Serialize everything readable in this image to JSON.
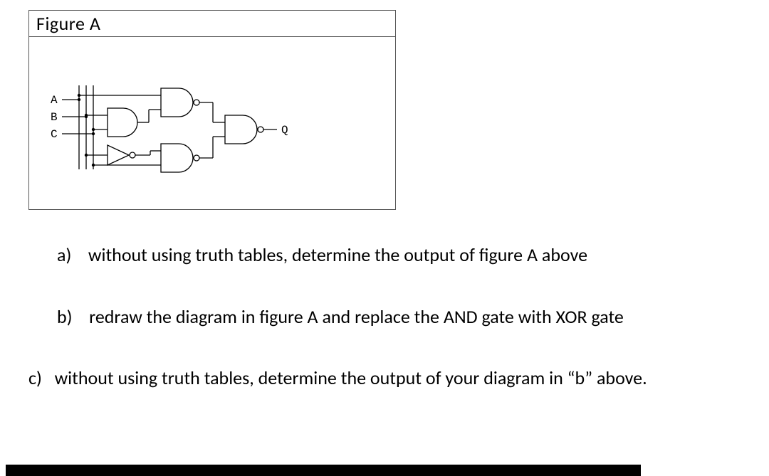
{
  "figure": {
    "title": "Figure A",
    "inputs": {
      "A": "A",
      "B": "B",
      "C": "C"
    },
    "output": "Q"
  },
  "questions": {
    "a": {
      "label": "a)",
      "text": "without using truth tables, determine the output of figure A above"
    },
    "b": {
      "label": "b)",
      "text": "redraw the diagram in figure A and replace the AND gate with XOR gate"
    },
    "c": {
      "label": "c)",
      "text": "without using truth tables, determine the output of your diagram in “b” above."
    }
  }
}
